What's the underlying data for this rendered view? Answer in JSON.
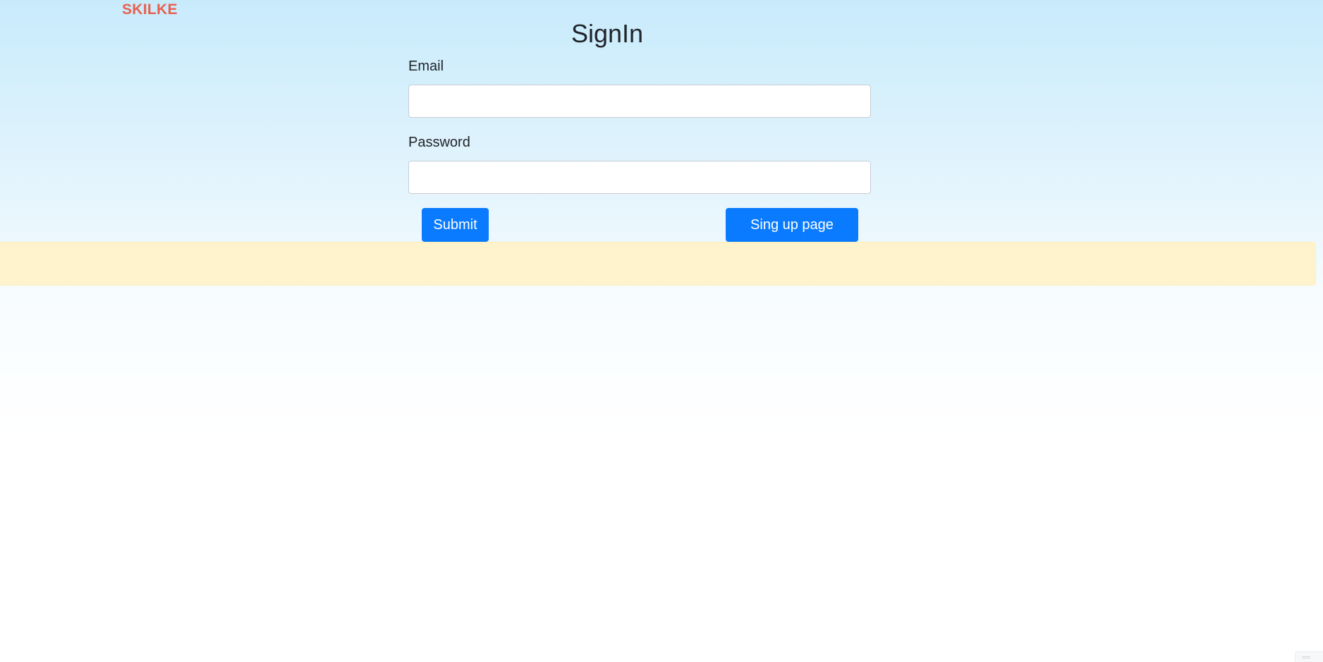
{
  "brand": {
    "name": "SKILKE"
  },
  "form": {
    "title": "SignIn",
    "email_label": "Email",
    "email_value": "",
    "password_label": "Password",
    "password_value": "",
    "submit_label": "Submit",
    "signup_label": "Sing up page"
  },
  "colors": {
    "brand": "#e9604f",
    "primary_button": "#0a7bff",
    "banner": "#fff3cd",
    "background_top": "#c8ebfc"
  }
}
